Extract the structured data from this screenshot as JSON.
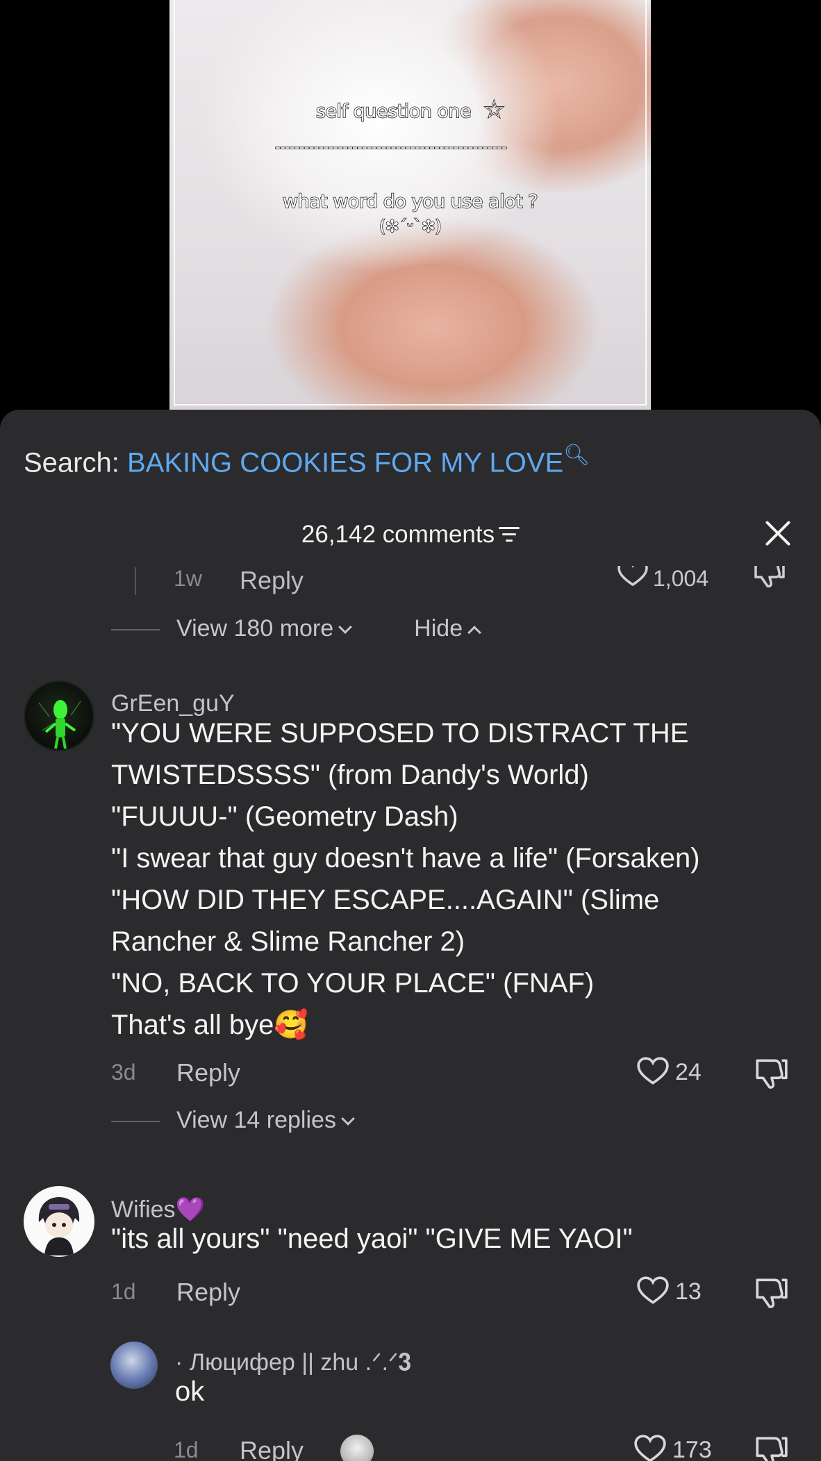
{
  "video": {
    "overlay_title": "self question one",
    "overlay_star": "☆",
    "overlay_divider": "------------------------------------------------",
    "overlay_question": "what word do you use alot ?",
    "overlay_face": "(✼ˊᵕˋ✼)"
  },
  "search": {
    "label": "Search: ",
    "query": "BAKING COOKIES FOR MY LOVE"
  },
  "header": {
    "comments_count": "26,142 comments"
  },
  "previous_reply": {
    "time": "1w",
    "reply_label": "Reply",
    "likes": "1,004"
  },
  "thread_controls": {
    "view_more": "View 180 more",
    "hide": "Hide"
  },
  "comments": [
    {
      "username": "GrEen_guY",
      "text": "\"YOU WERE SUPPOSED TO DISTRACT THE\nTWISTEDSSSS\" (from Dandy's World)\n\"FUUUU-\" (Geometry Dash)\n\"I swear that guy doesn't have a life\" (Forsaken)\n\"HOW DID THEY ESCAPE....AGAIN\" (Slime\nRancher & Slime Rancher 2)\n\"NO, BACK TO YOUR PLACE\" (FNAF)\nThat's all bye🥰",
      "time": "3d",
      "reply_label": "Reply",
      "likes": "24",
      "view_replies": "View 14 replies"
    },
    {
      "username": "Wifies💜",
      "text": "\"its all yours\" \"need yaoi\" \"GIVE ME YAOI\"",
      "time": "1d",
      "reply_label": "Reply",
      "likes": "13"
    }
  ],
  "reply": {
    "username": "· Люцифер || zhu .ᐟ.ᐟ𝟑",
    "text": "ok",
    "time": "1d",
    "reply_label": "Reply",
    "likes": "173"
  },
  "colors": {
    "sheet_bg": "#2b2b2d",
    "search_query": "#5ea9f0",
    "text_primary": "#f4f4f5",
    "text_muted": "#8b8b8f"
  }
}
